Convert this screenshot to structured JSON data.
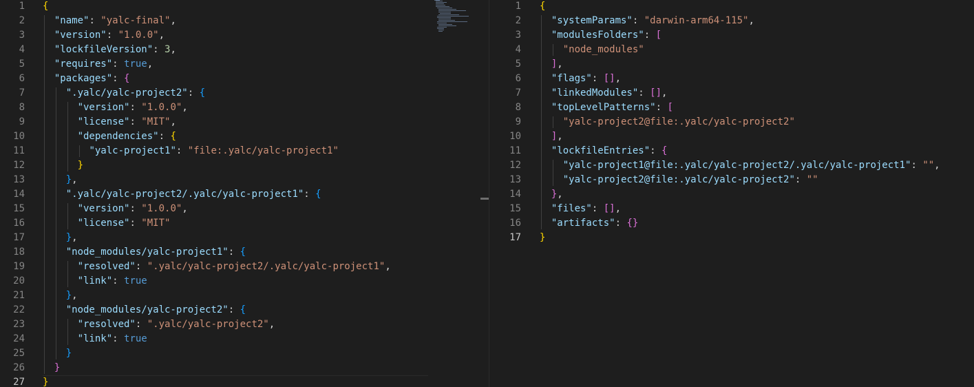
{
  "left_editor": {
    "lines": [
      [
        {
          "t": "{",
          "c": "b1"
        }
      ],
      [
        {
          "t": "  "
        },
        {
          "t": "\"name\"",
          "c": "tk-key"
        },
        {
          "t": ": "
        },
        {
          "t": "\"yalc-final\"",
          "c": "tk-str"
        },
        {
          "t": ","
        }
      ],
      [
        {
          "t": "  "
        },
        {
          "t": "\"version\"",
          "c": "tk-key"
        },
        {
          "t": ": "
        },
        {
          "t": "\"1.0.0\"",
          "c": "tk-str"
        },
        {
          "t": ","
        }
      ],
      [
        {
          "t": "  "
        },
        {
          "t": "\"lockfileVersion\"",
          "c": "tk-key"
        },
        {
          "t": ": "
        },
        {
          "t": "3",
          "c": "tk-num"
        },
        {
          "t": ","
        }
      ],
      [
        {
          "t": "  "
        },
        {
          "t": "\"requires\"",
          "c": "tk-key"
        },
        {
          "t": ": "
        },
        {
          "t": "true",
          "c": "tk-bool"
        },
        {
          "t": ","
        }
      ],
      [
        {
          "t": "  "
        },
        {
          "t": "\"packages\"",
          "c": "tk-key"
        },
        {
          "t": ": "
        },
        {
          "t": "{",
          "c": "b2"
        }
      ],
      [
        {
          "t": "    "
        },
        {
          "t": "\".yalc/yalc-project2\"",
          "c": "tk-key"
        },
        {
          "t": ": "
        },
        {
          "t": "{",
          "c": "b3"
        }
      ],
      [
        {
          "t": "      "
        },
        {
          "t": "\"version\"",
          "c": "tk-key"
        },
        {
          "t": ": "
        },
        {
          "t": "\"1.0.0\"",
          "c": "tk-str"
        },
        {
          "t": ","
        }
      ],
      [
        {
          "t": "      "
        },
        {
          "t": "\"license\"",
          "c": "tk-key"
        },
        {
          "t": ": "
        },
        {
          "t": "\"MIT\"",
          "c": "tk-str"
        },
        {
          "t": ","
        }
      ],
      [
        {
          "t": "      "
        },
        {
          "t": "\"dependencies\"",
          "c": "tk-key"
        },
        {
          "t": ": "
        },
        {
          "t": "{",
          "c": "b1"
        }
      ],
      [
        {
          "t": "        "
        },
        {
          "t": "\"yalc-project1\"",
          "c": "tk-key"
        },
        {
          "t": ": "
        },
        {
          "t": "\"file:.yalc/yalc-project1\"",
          "c": "tk-str"
        }
      ],
      [
        {
          "t": "      "
        },
        {
          "t": "}",
          "c": "b1"
        }
      ],
      [
        {
          "t": "    "
        },
        {
          "t": "}",
          "c": "b3"
        },
        {
          "t": ","
        }
      ],
      [
        {
          "t": "    "
        },
        {
          "t": "\".yalc/yalc-project2/.yalc/yalc-project1\"",
          "c": "tk-key"
        },
        {
          "t": ": "
        },
        {
          "t": "{",
          "c": "b3"
        }
      ],
      [
        {
          "t": "      "
        },
        {
          "t": "\"version\"",
          "c": "tk-key"
        },
        {
          "t": ": "
        },
        {
          "t": "\"1.0.0\"",
          "c": "tk-str"
        },
        {
          "t": ","
        }
      ],
      [
        {
          "t": "      "
        },
        {
          "t": "\"license\"",
          "c": "tk-key"
        },
        {
          "t": ": "
        },
        {
          "t": "\"MIT\"",
          "c": "tk-str"
        }
      ],
      [
        {
          "t": "    "
        },
        {
          "t": "}",
          "c": "b3"
        },
        {
          "t": ","
        }
      ],
      [
        {
          "t": "    "
        },
        {
          "t": "\"node_modules/yalc-project1\"",
          "c": "tk-key"
        },
        {
          "t": ": "
        },
        {
          "t": "{",
          "c": "b3"
        }
      ],
      [
        {
          "t": "      "
        },
        {
          "t": "\"resolved\"",
          "c": "tk-key"
        },
        {
          "t": ": "
        },
        {
          "t": "\".yalc/yalc-project2/.yalc/yalc-project1\"",
          "c": "tk-str"
        },
        {
          "t": ","
        }
      ],
      [
        {
          "t": "      "
        },
        {
          "t": "\"link\"",
          "c": "tk-key"
        },
        {
          "t": ": "
        },
        {
          "t": "true",
          "c": "tk-bool"
        }
      ],
      [
        {
          "t": "    "
        },
        {
          "t": "}",
          "c": "b3"
        },
        {
          "t": ","
        }
      ],
      [
        {
          "t": "    "
        },
        {
          "t": "\"node_modules/yalc-project2\"",
          "c": "tk-key"
        },
        {
          "t": ": "
        },
        {
          "t": "{",
          "c": "b3"
        }
      ],
      [
        {
          "t": "      "
        },
        {
          "t": "\"resolved\"",
          "c": "tk-key"
        },
        {
          "t": ": "
        },
        {
          "t": "\".yalc/yalc-project2\"",
          "c": "tk-str"
        },
        {
          "t": ","
        }
      ],
      [
        {
          "t": "      "
        },
        {
          "t": "\"link\"",
          "c": "tk-key"
        },
        {
          "t": ": "
        },
        {
          "t": "true",
          "c": "tk-bool"
        }
      ],
      [
        {
          "t": "    "
        },
        {
          "t": "}",
          "c": "b3"
        }
      ],
      [
        {
          "t": "  "
        },
        {
          "t": "}",
          "c": "b2"
        }
      ],
      [
        {
          "t": "}",
          "c": "b1"
        }
      ]
    ],
    "line_numbers": [
      "1",
      "2",
      "3",
      "4",
      "5",
      "6",
      "7",
      "8",
      "9",
      "10",
      "11",
      "12",
      "13",
      "14",
      "15",
      "16",
      "17",
      "18",
      "19",
      "20",
      "21",
      "22",
      "23",
      "24",
      "25",
      "26",
      "27"
    ],
    "active_line": "27"
  },
  "right_editor": {
    "lines": [
      [
        {
          "t": "{",
          "c": "b1"
        }
      ],
      [
        {
          "t": "  "
        },
        {
          "t": "\"systemParams\"",
          "c": "tk-key"
        },
        {
          "t": ": "
        },
        {
          "t": "\"darwin-arm64-115\"",
          "c": "tk-str"
        },
        {
          "t": ","
        }
      ],
      [
        {
          "t": "  "
        },
        {
          "t": "\"modulesFolders\"",
          "c": "tk-key"
        },
        {
          "t": ": "
        },
        {
          "t": "[",
          "c": "b2"
        }
      ],
      [
        {
          "t": "    "
        },
        {
          "t": "\"node_modules\"",
          "c": "tk-str"
        }
      ],
      [
        {
          "t": "  "
        },
        {
          "t": "]",
          "c": "b2"
        },
        {
          "t": ","
        }
      ],
      [
        {
          "t": "  "
        },
        {
          "t": "\"flags\"",
          "c": "tk-key"
        },
        {
          "t": ": "
        },
        {
          "t": "[]",
          "c": "b2"
        },
        {
          "t": ","
        }
      ],
      [
        {
          "t": "  "
        },
        {
          "t": "\"linkedModules\"",
          "c": "tk-key"
        },
        {
          "t": ": "
        },
        {
          "t": "[]",
          "c": "b2"
        },
        {
          "t": ","
        }
      ],
      [
        {
          "t": "  "
        },
        {
          "t": "\"topLevelPatterns\"",
          "c": "tk-key"
        },
        {
          "t": ": "
        },
        {
          "t": "[",
          "c": "b2"
        }
      ],
      [
        {
          "t": "    "
        },
        {
          "t": "\"yalc-project2@file:.yalc/yalc-project2\"",
          "c": "tk-str"
        }
      ],
      [
        {
          "t": "  "
        },
        {
          "t": "]",
          "c": "b2"
        },
        {
          "t": ","
        }
      ],
      [
        {
          "t": "  "
        },
        {
          "t": "\"lockfileEntries\"",
          "c": "tk-key"
        },
        {
          "t": ": "
        },
        {
          "t": "{",
          "c": "b2"
        }
      ],
      [
        {
          "t": "    "
        },
        {
          "t": "\"yalc-project1@file:.yalc/yalc-project2/.yalc/yalc-project1\"",
          "c": "tk-key"
        },
        {
          "t": ": "
        },
        {
          "t": "\"\"",
          "c": "tk-str"
        },
        {
          "t": ","
        }
      ],
      [
        {
          "t": "    "
        },
        {
          "t": "\"yalc-project2@file:.yalc/yalc-project2\"",
          "c": "tk-key"
        },
        {
          "t": ": "
        },
        {
          "t": "\"\"",
          "c": "tk-str"
        }
      ],
      [
        {
          "t": "  "
        },
        {
          "t": "}",
          "c": "b2"
        },
        {
          "t": ","
        }
      ],
      [
        {
          "t": "  "
        },
        {
          "t": "\"files\"",
          "c": "tk-key"
        },
        {
          "t": ": "
        },
        {
          "t": "[]",
          "c": "b2"
        },
        {
          "t": ","
        }
      ],
      [
        {
          "t": "  "
        },
        {
          "t": "\"artifacts\"",
          "c": "tk-key"
        },
        {
          "t": ": "
        },
        {
          "t": "{}",
          "c": "b2"
        }
      ],
      [
        {
          "t": "}",
          "c": "b1"
        }
      ]
    ],
    "line_numbers": [
      "1",
      "2",
      "3",
      "4",
      "5",
      "6",
      "7",
      "8",
      "9",
      "10",
      "11",
      "12",
      "13",
      "14",
      "15",
      "16",
      "17"
    ],
    "active_line": "17"
  },
  "colors": {
    "background": "#1e1e1e",
    "line_number": "#858585",
    "key": "#9cdcfe",
    "string": "#ce9178",
    "number": "#b5cea8",
    "boolean": "#569cd6",
    "bracket_level1": "#ffd700",
    "bracket_level2": "#da70d6",
    "bracket_level3": "#179fff"
  }
}
